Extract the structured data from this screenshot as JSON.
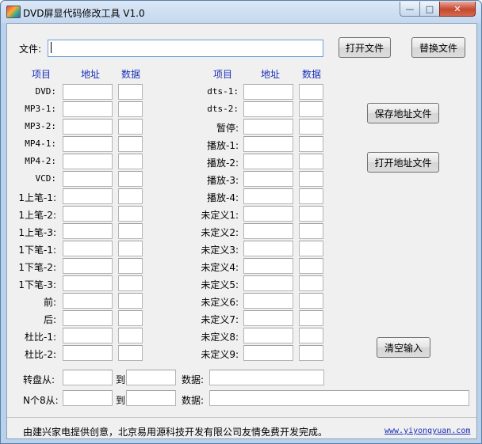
{
  "window": {
    "title": "DVD屏显代码修改工具 V1.0"
  },
  "file_row": {
    "label": "文件:",
    "value": "",
    "open_label": "打开文件",
    "replace_label": "替换文件"
  },
  "headers": {
    "item": "项目",
    "address": "地址",
    "data": "数据"
  },
  "left_items": [
    "DVD:",
    "MP3-1:",
    "MP3-2:",
    "MP4-1:",
    "MP4-2:",
    "VCD:",
    "1上笔-1:",
    "1上笔-2:",
    "1上笔-3:",
    "1下笔-1:",
    "1下笔-2:",
    "1下笔-3:",
    "前:",
    "后:",
    "杜比-1:",
    "杜比-2:"
  ],
  "right_items": [
    "dts-1:",
    "dts-2:",
    "暂停:",
    "播放-1:",
    "播放-2:",
    "播放-3:",
    "播放-4:",
    "未定义1:",
    "未定义2:",
    "未定义3:",
    "未定义4:",
    "未定义5:",
    "未定义6:",
    "未定义7:",
    "未定义8:",
    "未定义9:"
  ],
  "buttons": {
    "save_addr": "保存地址文件",
    "open_addr": "打开地址文件",
    "clear_input": "清空输入"
  },
  "dial": {
    "from_label": "转盘从:",
    "to_label": "到",
    "data_label": "数据:"
  },
  "n8": {
    "from_label": "N个8从:",
    "to_label": "到",
    "data_label": "数据:"
  },
  "footer": {
    "credit": "由建兴家电提供创意，北京易用源科技开发有限公司友情免费开发完成。",
    "link": "www.yiyongyuan.com"
  }
}
